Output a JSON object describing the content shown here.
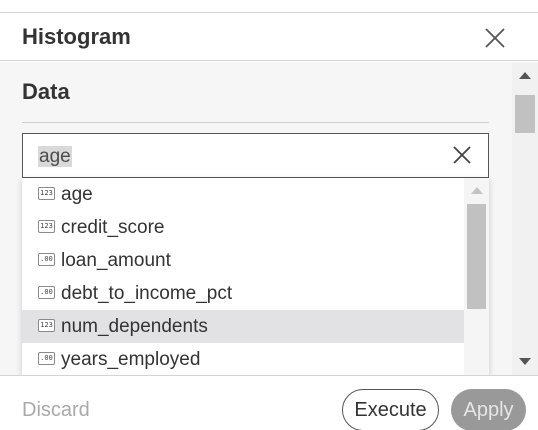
{
  "dialog": {
    "title": "Histogram",
    "close_icon": "close-icon"
  },
  "section": {
    "title": "Data"
  },
  "search": {
    "value": "age",
    "clear_icon": "clear-icon"
  },
  "dropdown": {
    "items": [
      {
        "label": "age",
        "type_icon": "integer-type-icon",
        "type_glyph": "123",
        "highlighted": false
      },
      {
        "label": "credit_score",
        "type_icon": "integer-type-icon",
        "type_glyph": "123",
        "highlighted": false
      },
      {
        "label": "loan_amount",
        "type_icon": "decimal-type-icon",
        "type_glyph": ".00",
        "highlighted": false
      },
      {
        "label": "debt_to_income_pct",
        "type_icon": "decimal-type-icon",
        "type_glyph": ".00",
        "highlighted": false
      },
      {
        "label": "num_dependents",
        "type_icon": "integer-type-icon",
        "type_glyph": "123",
        "highlighted": true
      },
      {
        "label": "years_employed",
        "type_icon": "decimal-type-icon",
        "type_glyph": ".00",
        "highlighted": false
      }
    ]
  },
  "footer": {
    "discard_label": "Discard",
    "execute_label": "Execute",
    "apply_label": "Apply"
  },
  "colors": {
    "highlight_row": "#e2e2e4",
    "apply_bg": "#999999",
    "discard_text": "#a9a9a9"
  }
}
